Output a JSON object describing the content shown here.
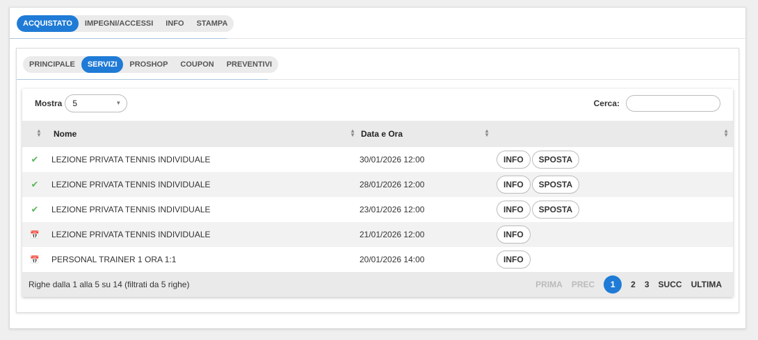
{
  "top_tabs": [
    {
      "label": "ACQUISTATO",
      "active": true
    },
    {
      "label": "IMPEGNI/ACCESSI",
      "active": false
    },
    {
      "label": "INFO",
      "active": false
    },
    {
      "label": "STAMPA",
      "active": false
    }
  ],
  "sub_tabs": [
    {
      "label": "PRINCIPALE",
      "active": false
    },
    {
      "label": "SERVIZI",
      "active": true
    },
    {
      "label": "PROSHOP",
      "active": false
    },
    {
      "label": "COUPON",
      "active": false
    },
    {
      "label": "PREVENTIVI",
      "active": false
    }
  ],
  "controls": {
    "mostra_label": "Mostra",
    "mostra_value": "5",
    "cerca_label": "Cerca:",
    "cerca_value": ""
  },
  "table": {
    "headers": [
      "",
      "Nome",
      "Data e Ora",
      ""
    ],
    "rows": [
      {
        "status": "check-icon",
        "name": "LEZIONE PRIVATA TENNIS INDIVIDUALE",
        "datetime": "30/01/2026 12:00",
        "actions": [
          "INFO",
          "SPOSTA"
        ]
      },
      {
        "status": "check-icon",
        "name": "LEZIONE PRIVATA TENNIS INDIVIDUALE",
        "datetime": "28/01/2026 12:00",
        "actions": [
          "INFO",
          "SPOSTA"
        ]
      },
      {
        "status": "check-icon",
        "name": "LEZIONE PRIVATA TENNIS INDIVIDUALE",
        "datetime": "23/01/2026 12:00",
        "actions": [
          "INFO",
          "SPOSTA"
        ]
      },
      {
        "status": "calendar-icon",
        "name": "LEZIONE PRIVATA TENNIS INDIVIDUALE",
        "datetime": "21/01/2026 12:00",
        "actions": [
          "INFO"
        ]
      },
      {
        "status": "calendar-icon",
        "name": "PERSONAL TRAINER 1 ORA 1:1",
        "datetime": "20/01/2026 14:00",
        "actions": [
          "INFO"
        ]
      }
    ]
  },
  "footer": {
    "info": "Righe dalla 1 alla 5 su 14 (filtrati da 5 righe)",
    "first": "PRIMA",
    "prev": "PREC",
    "pages": [
      "1",
      "2",
      "3"
    ],
    "current_page": "1",
    "next": "SUCC",
    "last": "ULTIMA"
  },
  "colors": {
    "accent": "#1f7bd6",
    "ok": "#5cb85c",
    "calendar": "#d9534f"
  }
}
